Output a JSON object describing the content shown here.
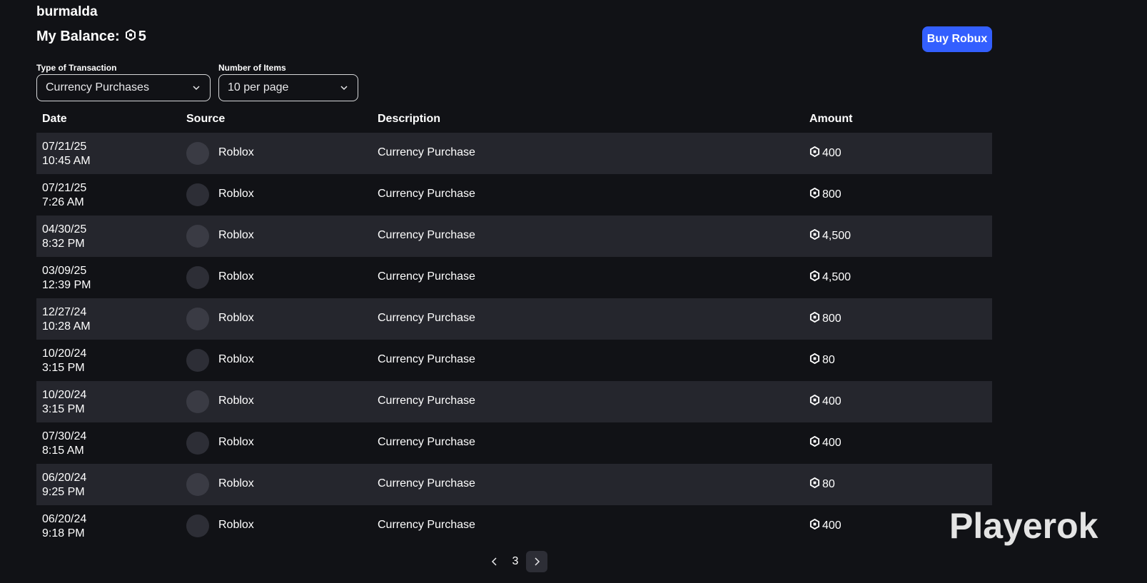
{
  "user": {
    "username": "burmalda"
  },
  "balance": {
    "label": "My Balance:",
    "amount": "5",
    "icon": "robux-icon"
  },
  "buy_button": {
    "label": "Buy Robux"
  },
  "filters": {
    "type": {
      "label": "Type of Transaction",
      "value": "Currency Purchases"
    },
    "count": {
      "label": "Number of Items",
      "value": "10 per page"
    }
  },
  "table": {
    "headers": {
      "date": "Date",
      "source": "Source",
      "description": "Description",
      "amount": "Amount"
    },
    "rows": [
      {
        "date": "07/21/25",
        "time": "10:45 AM",
        "source": "Roblox",
        "description": "Currency Purchase",
        "amount": "400"
      },
      {
        "date": "07/21/25",
        "time": "7:26 AM",
        "source": "Roblox",
        "description": "Currency Purchase",
        "amount": "800"
      },
      {
        "date": "04/30/25",
        "time": "8:32 PM",
        "source": "Roblox",
        "description": "Currency Purchase",
        "amount": "4,500"
      },
      {
        "date": "03/09/25",
        "time": "12:39 PM",
        "source": "Roblox",
        "description": "Currency Purchase",
        "amount": "4,500"
      },
      {
        "date": "12/27/24",
        "time": "10:28 AM",
        "source": "Roblox",
        "description": "Currency Purchase",
        "amount": "800"
      },
      {
        "date": "10/20/24",
        "time": "3:15 PM",
        "source": "Roblox",
        "description": "Currency Purchase",
        "amount": "80"
      },
      {
        "date": "10/20/24",
        "time": "3:15 PM",
        "source": "Roblox",
        "description": "Currency Purchase",
        "amount": "400"
      },
      {
        "date": "07/30/24",
        "time": "8:15 AM",
        "source": "Roblox",
        "description": "Currency Purchase",
        "amount": "400"
      },
      {
        "date": "06/20/24",
        "time": "9:25 PM",
        "source": "Roblox",
        "description": "Currency Purchase",
        "amount": "80"
      },
      {
        "date": "06/20/24",
        "time": "9:18 PM",
        "source": "Roblox",
        "description": "Currency Purchase",
        "amount": "400"
      }
    ]
  },
  "pagination": {
    "current_page": "3"
  },
  "watermark": {
    "text": "Playerok"
  },
  "colors": {
    "background": "#111216",
    "row_alt": "#25262d",
    "accent": "#335fff"
  }
}
